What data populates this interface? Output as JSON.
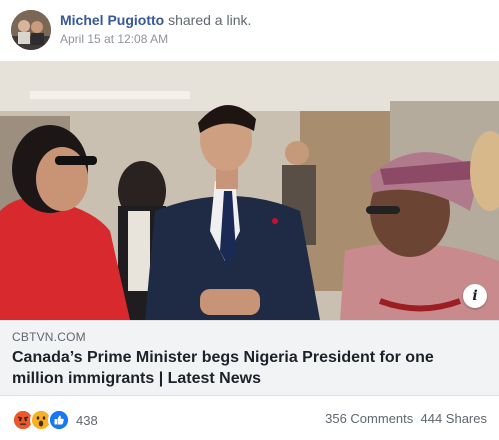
{
  "post": {
    "author": "Michel Pugiotto",
    "action": "shared a link.",
    "timestamp": "April 15 at 12:08 AM"
  },
  "link": {
    "domain": "CBTVN.COM",
    "title": "Canada’s Prime Minister begs Nigeria President for one million immigrants | Latest News",
    "info_icon": "i"
  },
  "footer": {
    "reaction_icons": [
      "angry-icon",
      "wow-icon",
      "like-icon"
    ],
    "reaction_count": "438",
    "comments": "356 Comments",
    "shares": "444 Shares"
  },
  "colors": {
    "link_blue": "#385898",
    "meta_gray": "#90949c",
    "angry": "#f07c33",
    "wow": "#f7b125",
    "like": "#1877f2"
  }
}
